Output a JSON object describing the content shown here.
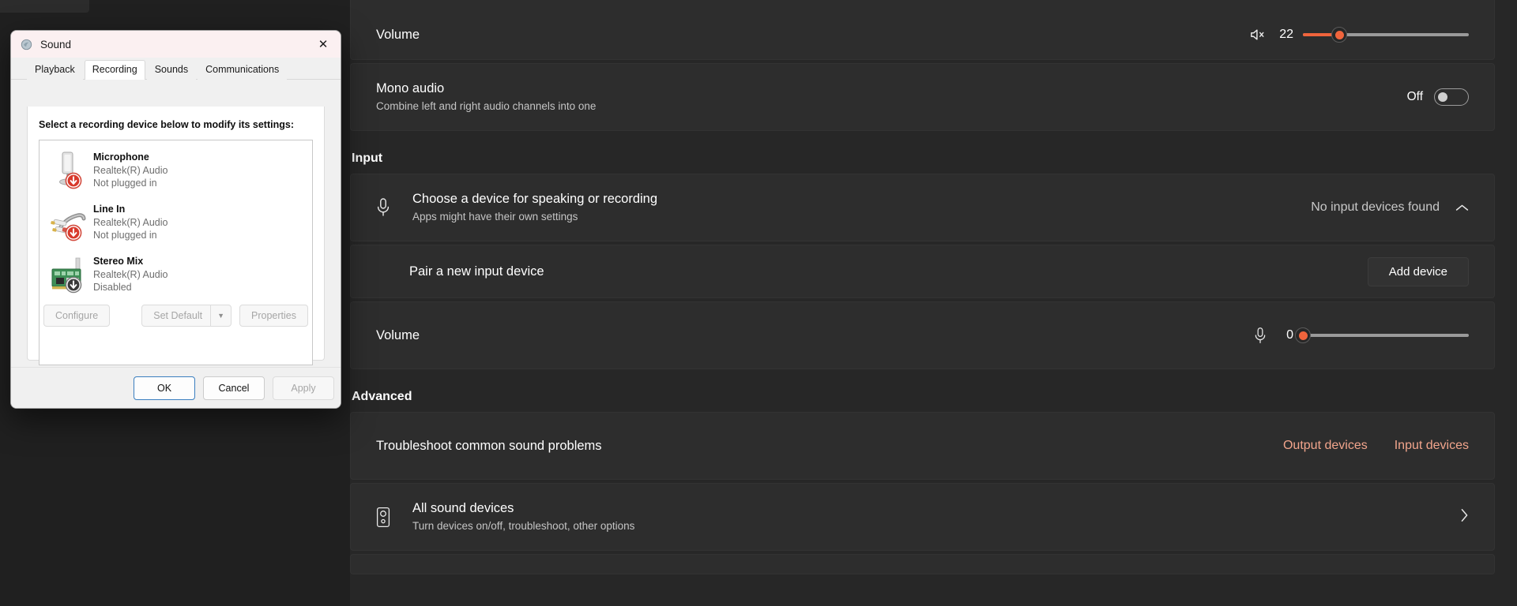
{
  "theme": {
    "accent": "#f0643c",
    "link_accent": "#f2a58c",
    "settings_bg": "#272727",
    "card_bg": "#2d2d2d",
    "dialog_bg": "#f0f0f0"
  },
  "settings": {
    "output": {
      "volume": {
        "label": "Volume",
        "value": "22",
        "percent": 22,
        "icon": "speaker-muted-icon"
      },
      "mono_audio": {
        "title": "Mono audio",
        "subtitle": "Combine left and right audio channels into one",
        "toggle_label": "Off",
        "toggle_state": "off"
      }
    },
    "input": {
      "section_header": "Input",
      "choose_device": {
        "title": "Choose a device for speaking or recording",
        "subtitle": "Apps might have their own settings",
        "status": "No input devices found",
        "icon": "microphone-icon",
        "chevron": "chevron-up-icon"
      },
      "pair_device": {
        "label": "Pair a new input device",
        "button": "Add device"
      },
      "volume": {
        "label": "Volume",
        "value": "0",
        "percent": 0,
        "icon": "microphone-icon"
      }
    },
    "advanced": {
      "section_header": "Advanced",
      "troubleshoot": {
        "label": "Troubleshoot common sound problems",
        "link_output": "Output devices",
        "link_input": "Input devices"
      },
      "all_devices": {
        "title": "All sound devices",
        "subtitle": "Turn devices on/off, troubleshoot, other options",
        "icon": "speaker-device-icon",
        "chevron": "chevron-right-icon"
      }
    }
  },
  "sound_dialog": {
    "title": "Sound",
    "title_icon": "sound-icon",
    "close_label": "✕",
    "tabs": [
      {
        "label": "Playback",
        "active": false
      },
      {
        "label": "Recording",
        "active": true
      },
      {
        "label": "Sounds",
        "active": false
      },
      {
        "label": "Communications",
        "active": false
      }
    ],
    "caption": "Select a recording device below to modify its settings:",
    "devices": [
      {
        "name": "Microphone",
        "driver": "Realtek(R) Audio",
        "status": "Not plugged in",
        "icon": "microphone-device-icon",
        "badge": "red-down-arrow-badge"
      },
      {
        "name": "Line In",
        "driver": "Realtek(R) Audio",
        "status": "Not plugged in",
        "icon": "rca-cable-icon",
        "badge": "red-down-arrow-badge"
      },
      {
        "name": "Stereo Mix",
        "driver": "Realtek(R) Audio",
        "status": "Disabled",
        "icon": "pci-card-icon",
        "badge": "dark-down-arrow-badge"
      }
    ],
    "buttons": {
      "configure": "Configure",
      "set_default": "Set Default",
      "set_default_arrow": "▼",
      "properties": "Properties",
      "ok": "OK",
      "cancel": "Cancel",
      "apply": "Apply"
    }
  }
}
